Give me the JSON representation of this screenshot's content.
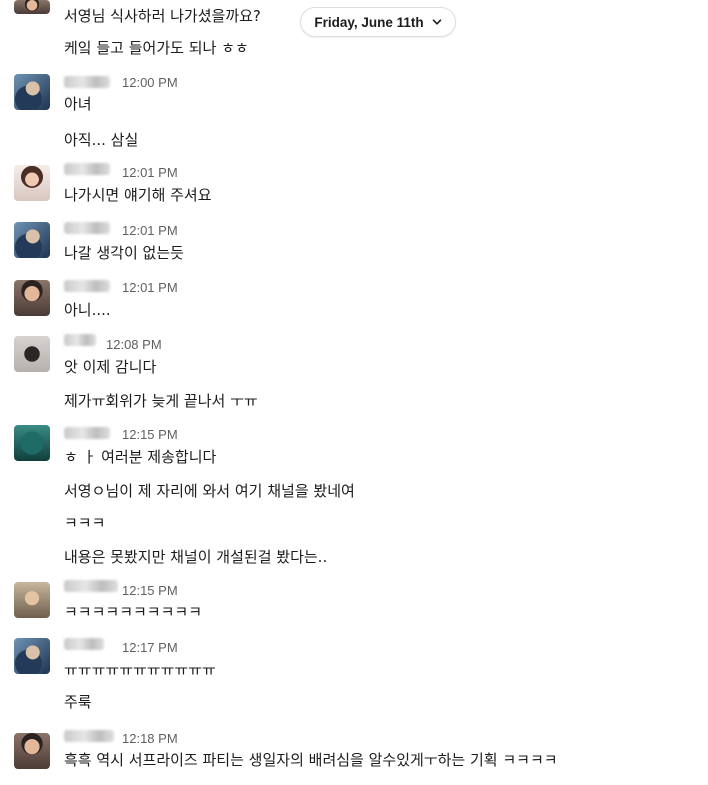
{
  "date_divider": {
    "label": "Friday, June 11th",
    "icon": "chevron-down-icon"
  },
  "messages": [
    {
      "time": "",
      "lines": [
        "서영님 식사하러 나가셨을까요?",
        "케잌 들고 들어가도 되나 ㅎㅎ"
      ]
    },
    {
      "time": "12:00 PM",
      "lines": [
        "아녀",
        "아직... 삼실"
      ]
    },
    {
      "time": "12:01 PM",
      "lines": [
        "나가시면 얘기해 주셔요"
      ]
    },
    {
      "time": "12:01 PM",
      "lines": [
        "나갈 생각이 없는듯"
      ]
    },
    {
      "time": "12:01 PM",
      "lines": [
        "아니...."
      ]
    },
    {
      "time": "12:08 PM",
      "lines": [
        "앗 이제 감니다",
        "제가ㅠ회위가 늦게 끝나서 ㅜㅠ"
      ]
    },
    {
      "time": "12:15 PM",
      "lines": [
        "ㅎ ㅏ 여러분 제송합니다",
        "서영ㅇ님이 제 자리에 와서 여기 채널을 봤네여",
        "ㅋㅋㅋ",
        "내용은 못봤지만 채널이 개설된걸 봤다는.."
      ]
    },
    {
      "time": "12:15 PM",
      "lines": [
        "ㅋㅋㅋㅋㅋㅋㅋㅋㅋㅋ"
      ]
    },
    {
      "time": "12:17 PM",
      "lines": [
        "ㅠㅠㅠㅠㅠㅠㅠㅠㅠㅠㅠ",
        "주룩"
      ]
    },
    {
      "time": "12:18 PM",
      "lines": [
        "흑흑 역시 서프라이즈 파티는 생일자의 배려심을 알수있게ㅜ하는 기획 ㅋㅋㅋㅋ"
      ]
    }
  ]
}
